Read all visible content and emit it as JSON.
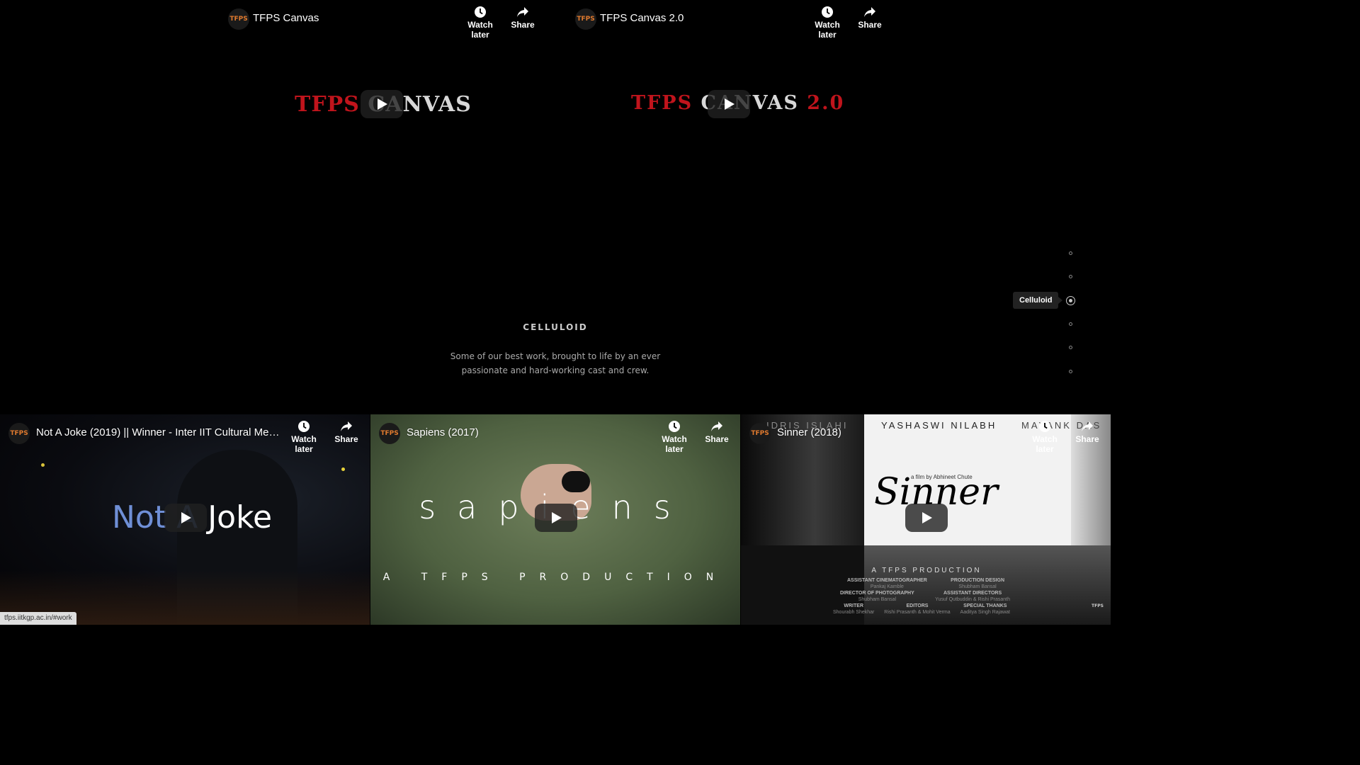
{
  "top_videos": [
    {
      "title": "TFPS Canvas",
      "logo_text": [
        "TFPS",
        "CANVAS"
      ]
    },
    {
      "title": "TFPS Canvas 2.0",
      "logo_text": [
        "TFPS",
        "CANVAS",
        "2.0"
      ]
    }
  ],
  "controls": {
    "watch_later": "Watch later",
    "share": "Share"
  },
  "channel_logo_text": "TFPS",
  "section": {
    "title": "CELLULOID",
    "description": "Some of our best work, brought to life by an ever passionate and hard-working cast and crew."
  },
  "side_nav": {
    "active_tooltip": "Celluloid"
  },
  "bottom_videos": [
    {
      "title": "Not A Joke (2019) || Winner - Inter IIT Cultural Meet...",
      "thumb_text": [
        "Not",
        "A",
        "Joke"
      ]
    },
    {
      "title": "Sapiens (2017)",
      "thumb_text": [
        "sapiens",
        "A TFPS PRODUCTION"
      ]
    },
    {
      "title": "Sinner (2018)",
      "thumb_text": {
        "names": [
          "IDRIS ISLAHI",
          "YASHASWI NILABH",
          "MAYANK DAS"
        ],
        "tagline": "a film by Abhineet Chute",
        "logo": "Sinner",
        "production": "A TFPS PRODUCTION",
        "credits": [
          "ASSISTANT CINEMATOGRAPHER",
          "Pankaj Kamble",
          "PRODUCTION DESIGN",
          "Shubham Bansal",
          "DIRECTOR OF PHOTOGRAPHY",
          "Shubham Bansal",
          "ASSISTANT DIRECTORS",
          "Yusuf Qutbuddin & Rishi Prasanth",
          "WRITER",
          "Shourabh Shekhar",
          "EDITORS",
          "Rishi Prasanth & Mohit Verma",
          "SPECIAL THANKS",
          "Aaditya Singh Rajawat"
        ]
      }
    }
  ],
  "status_url": "tfps.iitkgp.ac.in/#work",
  "colors": {
    "logo_red": "#c0141c",
    "logo_grey": "#d8d8d8",
    "accent_orange": "#e07a2e"
  }
}
